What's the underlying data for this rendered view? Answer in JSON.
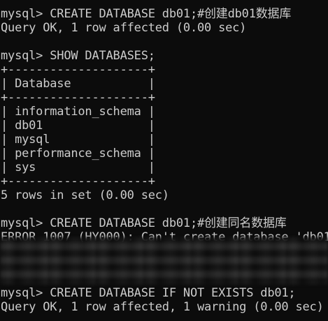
{
  "window": {
    "background_color": "#0c0c0c",
    "text_color": "#cccccc"
  },
  "terminal": {
    "lines": [
      "mysql> CREATE DATABASE db01;#创建db01数据库",
      "Query OK, 1 row affected (0.00 sec)",
      "",
      "mysql> SHOW DATABASES;",
      "+--------------------+",
      "| Database           |",
      "+--------------------+",
      "| information_schema |",
      "| db01               |",
      "| mysql              |",
      "| performance_schema |",
      "| sys                |",
      "+--------------------+",
      "5 rows in set (0.00 sec)",
      "",
      "mysql> CREATE DATABASE db01;#创建同名数据库",
      "ERROR 1007 (HY000): Can't create database 'db01",
      "",
      "",
      "",
      "mysql> CREATE DATABASE IF NOT EXISTS db01;",
      "Query OK, 1 row affected, 1 warning (0.00 sec)"
    ]
  }
}
